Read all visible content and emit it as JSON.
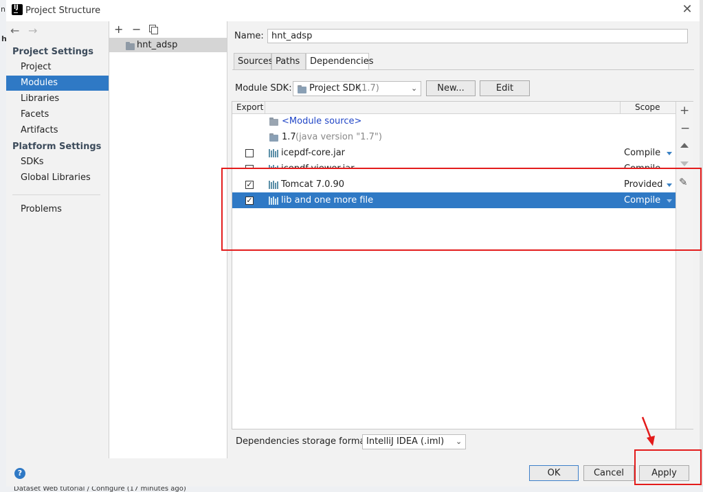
{
  "window": {
    "title": "Project Structure"
  },
  "background": {
    "left_text": "n",
    "bottom_text": "Dataset  Web                            tutorial  /  Configure  (17  minutes  ago)"
  },
  "nav": {
    "back_icon": "arrow-left-icon",
    "forward_icon": "arrow-right-icon",
    "project_settings": "Project Settings",
    "items_project": [
      "Project",
      "Modules",
      "Libraries",
      "Facets",
      "Artifacts"
    ],
    "platform_settings": "Platform Settings",
    "items_platform": [
      "SDKs",
      "Global Libraries"
    ],
    "problems": "Problems",
    "selected": "Modules"
  },
  "modules": {
    "toolbar": [
      "+",
      "−",
      "copy-icon"
    ],
    "list": [
      "hnt_adsp"
    ]
  },
  "editor": {
    "name_label": "Name:",
    "name_value": "hnt_adsp",
    "tabs": [
      "Sources",
      "Paths",
      "Dependencies"
    ],
    "active_tab": "Dependencies",
    "sdk_label": "Module SDK:",
    "sdk_value": "Project SDK",
    "sdk_version": "(1.7)",
    "new_button": "New...",
    "edit_button": "Edit",
    "table": {
      "col_export": "Export",
      "col_scope": "Scope",
      "rows": [
        {
          "name": "<Module source>",
          "checkbox": null,
          "scope": ""
        },
        {
          "name": "1.7",
          "suffix": "(java version \"1.7\")",
          "checkbox": null,
          "scope": ""
        },
        {
          "name": "icepdf-core.jar",
          "checkbox": false,
          "scope": "Compile"
        },
        {
          "name": "icepdf-viewer.jar",
          "checkbox": false,
          "scope": "Compile"
        },
        {
          "name": "Tomcat 7.0.90",
          "checkbox": true,
          "scope": "Provided"
        },
        {
          "name": "lib and one more file",
          "checkbox": true,
          "scope": "Compile",
          "selected": true
        }
      ]
    },
    "side_tools": [
      "+",
      "−",
      "move-up-icon",
      "move-down-icon",
      "edit-pencil-icon"
    ],
    "storage_label": "Dependencies storage format:",
    "storage_value": "IntelliJ IDEA (.iml)"
  },
  "footer": {
    "help": "?",
    "ok": "OK",
    "cancel": "Cancel",
    "apply": "Apply"
  },
  "colors": {
    "selection": "#2f79c5",
    "annotation": "#e31b1b",
    "link": "#2146c7"
  }
}
